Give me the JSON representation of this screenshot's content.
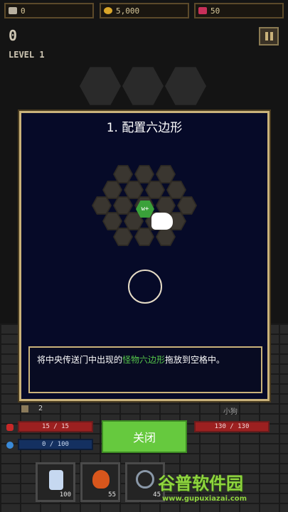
{
  "top_bar": {
    "skulls": "0",
    "gold": "5,000",
    "gems": "50"
  },
  "header": {
    "score": "0",
    "level": "LEVEL 1"
  },
  "modal": {
    "title": "1. 配置六边形",
    "text_before": "将中央传送门中出现的",
    "text_highlight": "怪物六边形",
    "text_after": "拖放到空格中。",
    "monster_hex_label": "w+"
  },
  "hud": {
    "bag_count": "2",
    "pet_name": "小狗",
    "hp_bar": "15 / 15",
    "mana_bar": "0 / 100",
    "pet_hp_bar": "130 / 130",
    "close_label": "关闭"
  },
  "inventory": [
    {
      "name": "potion",
      "cost": "100"
    },
    {
      "name": "fire",
      "cost": "55"
    },
    {
      "name": "shield",
      "cost": "45"
    }
  ],
  "watermark": {
    "text": "谷普软件园",
    "url": "www.gupuxiazai.com"
  }
}
